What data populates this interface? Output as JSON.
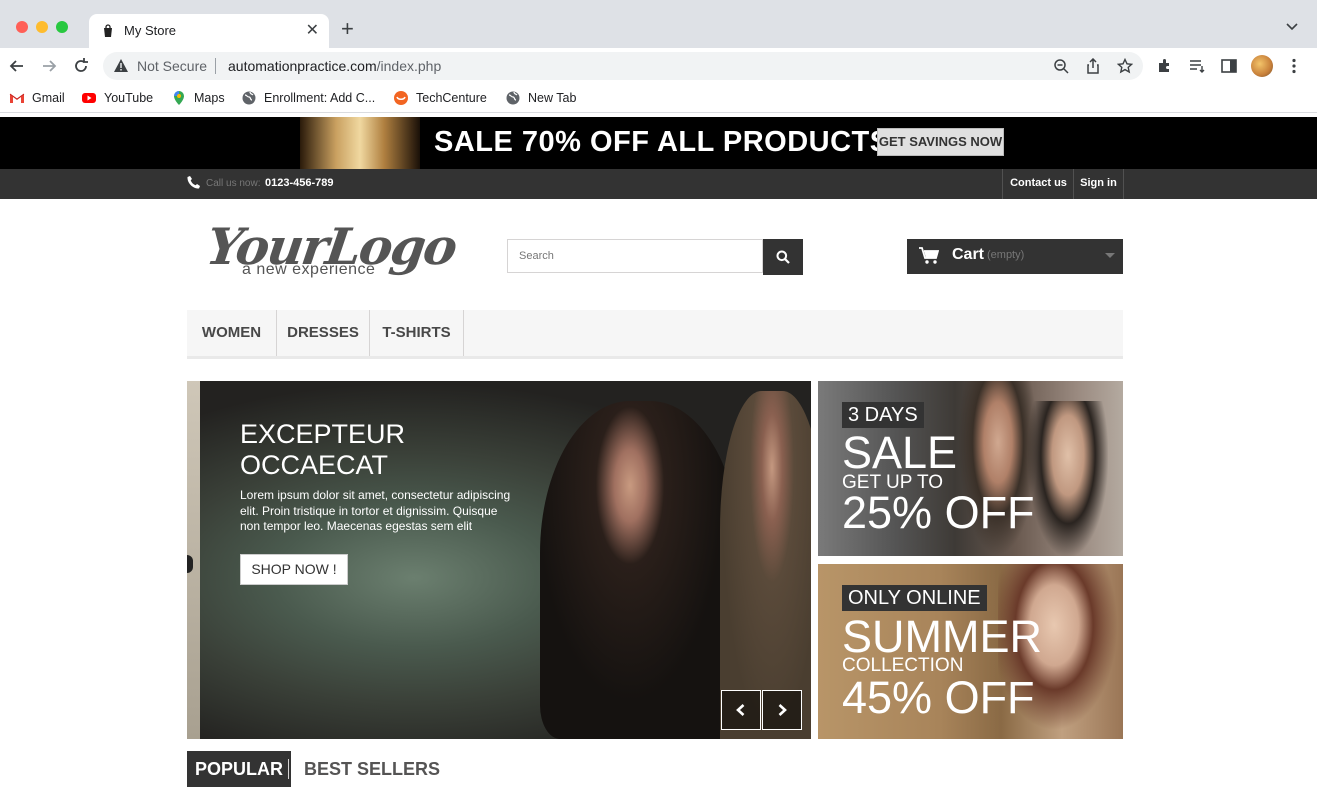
{
  "browser": {
    "tab_title": "My Store",
    "security_label": "Not Secure",
    "url_domain": "automationpractice.com",
    "url_path": "/index.php",
    "bookmarks": [
      {
        "label": "Gmail",
        "icon": "gmail-icon"
      },
      {
        "label": "YouTube",
        "icon": "youtube-icon"
      },
      {
        "label": "Maps",
        "icon": "maps-icon"
      },
      {
        "label": "Enrollment: Add C...",
        "icon": "globe-icon"
      },
      {
        "label": "TechCenture",
        "icon": "techcenture-icon"
      },
      {
        "label": "New Tab",
        "icon": "globe-icon"
      }
    ]
  },
  "promo": {
    "text": "SALE 70% OFF ALL PRODUCTS",
    "button": "GET SAVINGS NOW"
  },
  "header": {
    "call_label": "Call us now:",
    "phone": "0123-456-789",
    "contact": "Contact us",
    "signin": "Sign in"
  },
  "logo": {
    "main": "YourLogo",
    "tagline": "a new experience"
  },
  "search": {
    "placeholder": "Search"
  },
  "cart": {
    "label": "Cart",
    "status": "(empty)"
  },
  "menu": {
    "items": [
      "WOMEN",
      "DRESSES",
      "T-SHIRTS"
    ]
  },
  "slider": {
    "title_line1": "EXCEPTEUR",
    "title_line2": "OCCAECAT",
    "text": "Lorem ipsum dolor sit amet, consectetur adipiscing elit. Proin tristique in tortor et dignissim. Quisque non tempor leo. Maecenas egestas sem elit",
    "button": "SHOP NOW !"
  },
  "banners": [
    {
      "tag": "3 DAYS",
      "big": "SALE",
      "sub": "GET UP TO",
      "big2": "25% OFF"
    },
    {
      "tag": "ONLY ONLINE",
      "big": "SUMMER",
      "sub": "COLLECTION",
      "big2": "45% OFF"
    }
  ],
  "tabs": {
    "active": "POPULAR",
    "inactive": "BEST SELLERS"
  },
  "colors": {
    "dark": "#333333",
    "promo_bg": "#000000",
    "menu_bg": "#f6f6f6"
  }
}
